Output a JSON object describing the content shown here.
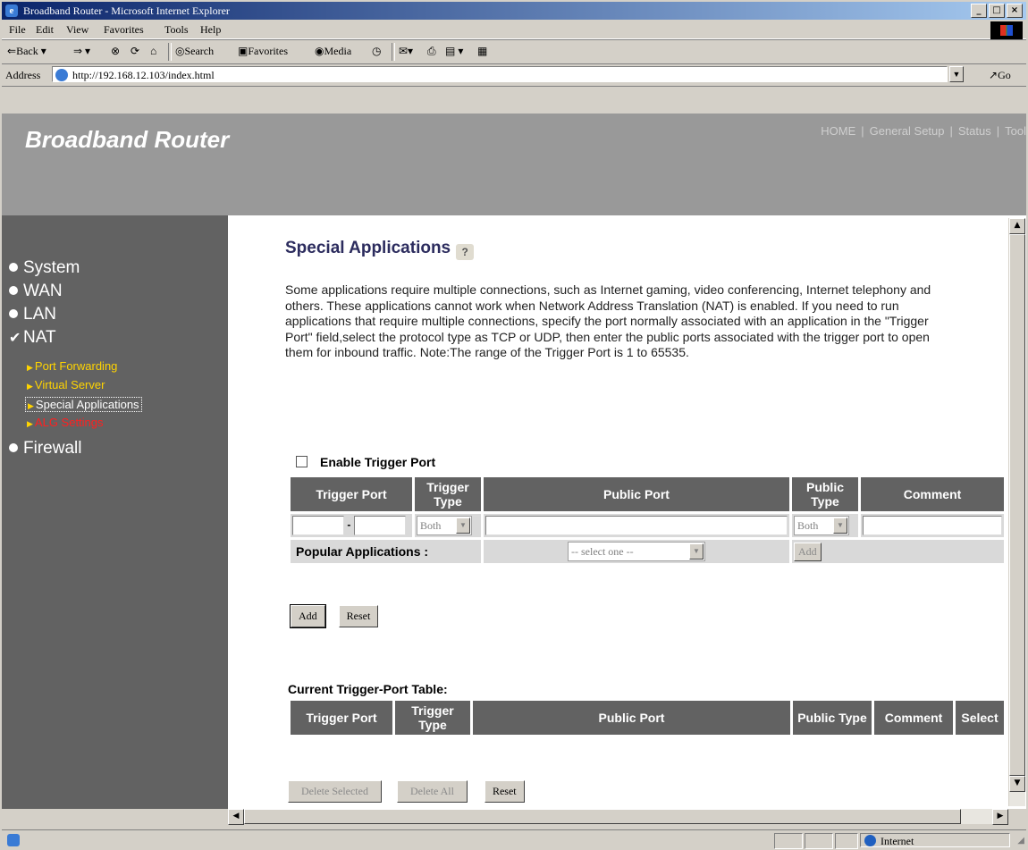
{
  "window": {
    "title": "Broadband Router - Microsoft Internet Explorer"
  },
  "menu": [
    "File",
    "Edit",
    "View",
    "Favorites",
    "Tools",
    "Help"
  ],
  "toolbar": {
    "back": "Back",
    "search": "Search",
    "favorites": "Favorites",
    "media": "Media"
  },
  "address": {
    "label": "Address",
    "url": "http://192.168.12.103/index.html",
    "go": "Go"
  },
  "banner": {
    "brand": "Broadband Router",
    "nav": [
      "HOME",
      "General Setup",
      "Status",
      "Tool"
    ]
  },
  "sidebar": {
    "items": [
      "System",
      "WAN",
      "LAN",
      "NAT",
      "Firewall"
    ],
    "nat_sub": [
      "Port Forwarding",
      "Virtual Server",
      "Special Applications",
      "ALG Settings"
    ]
  },
  "main": {
    "title": "Special Applications",
    "description": "Some applications require multiple connections, such as Internet gaming, video conferencing, Internet telephony and others. These applications cannot work when Network Address Translation (NAT) is enabled. If you need to run applications that require multiple connections, specify the port normally associated with an application in the \"Trigger Port\" field,select the protocol type as TCP or UDP, then enter the public ports associated with the trigger port to open them for inbound traffic. Note:The range of the Trigger Port is 1 to 65535.",
    "enable_label": "Enable Trigger Port",
    "enable_checked": false,
    "table_headers": [
      "Trigger Port",
      "Trigger Type",
      "Public Port",
      "Public Type",
      "Comment"
    ],
    "trigger_type_value": "Both",
    "public_type_value": "Both",
    "popular_label": "Popular Applications :",
    "popular_select": "-- select one --",
    "popular_add": "Add",
    "add_button": "Add",
    "reset_button": "Reset",
    "current_title": "Current Trigger-Port Table:",
    "current_headers": [
      "Trigger Port",
      "Trigger Type",
      "Public Port",
      "Public Type",
      "Comment",
      "Select"
    ],
    "delete_selected": "Delete Selected",
    "delete_all": "Delete All",
    "reset2": "Reset"
  },
  "status": {
    "zone": "Internet"
  }
}
